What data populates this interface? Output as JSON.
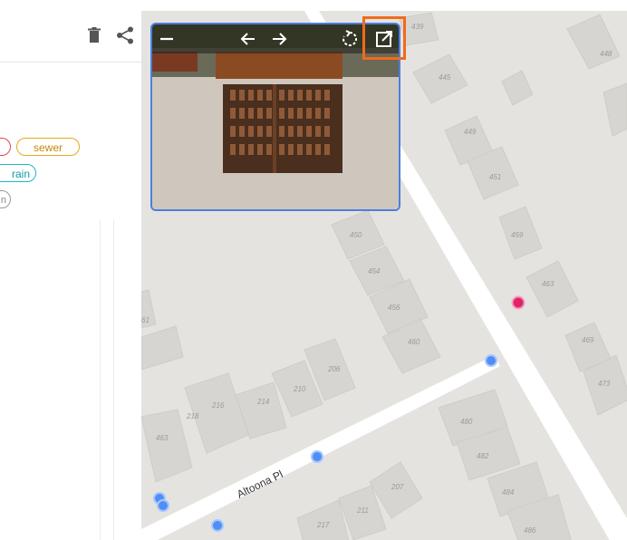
{
  "toolbar": {
    "trash_icon": "trash-icon",
    "share_icon": "share-icon"
  },
  "tags": [
    {
      "label": "",
      "color": "#e0474c"
    },
    {
      "label": "sewer",
      "color": "#e7a91b"
    },
    {
      "label": "rain",
      "color": "#1fb7c4"
    },
    {
      "label": "n",
      "color": "#9a9a9a"
    }
  ],
  "photo_viewer": {
    "icons": [
      "minimize-icon",
      "arrow-left-icon",
      "arrow-right-icon",
      "rotate-icon",
      "open-external-icon"
    ],
    "highlight_color": "#f26a1b",
    "border_color": "#4a7fe0"
  },
  "map": {
    "street_name": "Altoona Pl",
    "building_labels": [
      "439",
      "445",
      "448",
      "449",
      "451",
      "459",
      "463",
      "469",
      "473",
      "450",
      "454",
      "456",
      "460",
      "206",
      "210",
      "214",
      "218",
      "216",
      "463",
      "480",
      "482",
      "484",
      "486",
      "207",
      "211",
      "217",
      "61"
    ],
    "marker_colors": {
      "selected": "#e0246a",
      "point": "#4f8ef7"
    }
  }
}
